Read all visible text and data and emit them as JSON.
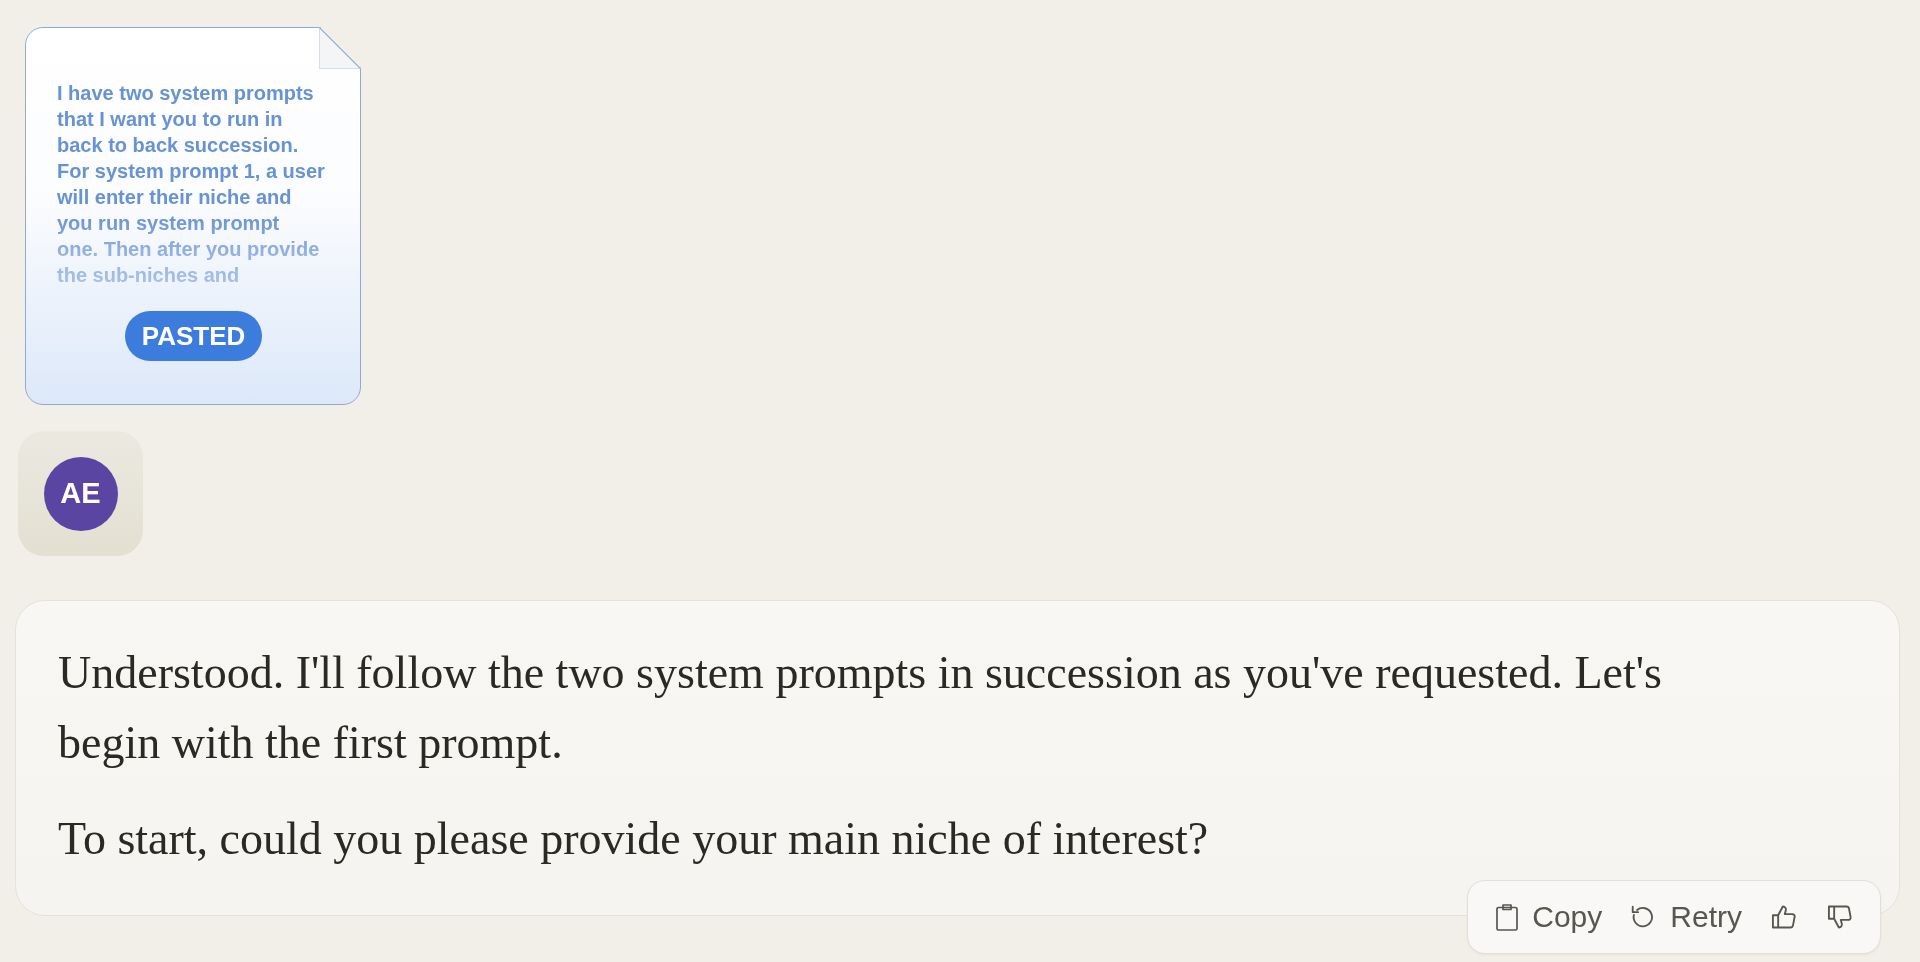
{
  "attachment": {
    "preview_text": "I have two system prompts that I want you to run in back to back succession. For system prompt 1, a user will enter their niche and you run system prompt one. Then after you provide the sub-niches and",
    "badge": "PASTED"
  },
  "user": {
    "avatar_initials": "AE"
  },
  "response": {
    "paragraphs": [
      "Understood. I'll follow the two system prompts in succession as you've requested. Let's begin with the first prompt.",
      "To start, could you please provide your main niche of interest?"
    ],
    "actions": [
      {
        "kind": "copy",
        "label": "Copy"
      },
      {
        "kind": "retry",
        "label": "Retry"
      },
      {
        "kind": "thumbs_up"
      },
      {
        "kind": "thumbs_down"
      }
    ]
  }
}
